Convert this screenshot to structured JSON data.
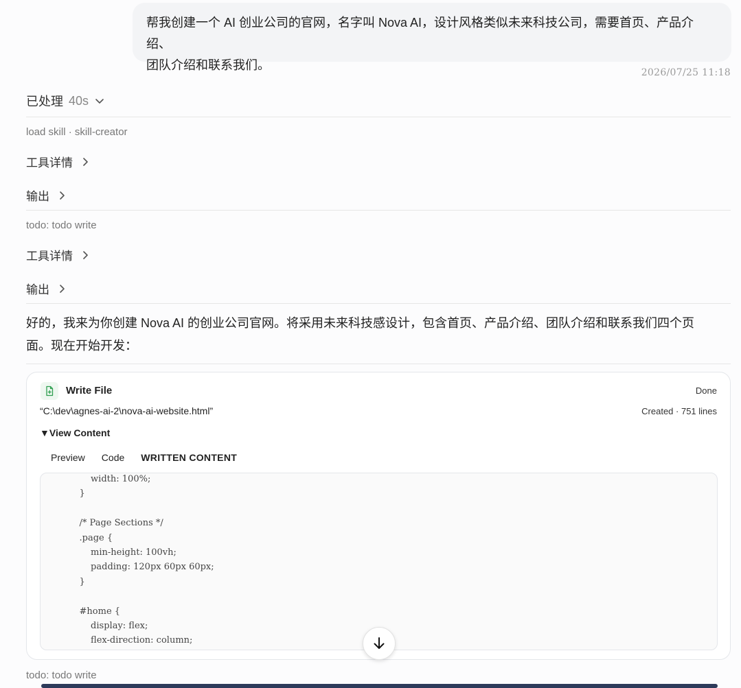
{
  "user_message": {
    "line1": "帮我创建一个 AI 创业公司的官网，名字叫 Nova AI，设计风格类似未来科技公司，需要首页、产品介绍、",
    "line2": "团队介绍和联系我们。",
    "timestamp": "2026/07/25  11:18"
  },
  "processed": {
    "label": "已处理",
    "duration": "40s"
  },
  "steps": [
    {
      "tool": "load skill · skill-creator",
      "details_label": "工具详情",
      "output_label": "输出"
    },
    {
      "tool": "todo: todo write",
      "details_label": "工具详情",
      "output_label": "输出"
    }
  ],
  "assistant": {
    "line1": "好的，我来为你创建 Nova AI 的创业公司官网。将采用未来科技感设计，包含首页、产品介绍、团队介绍和联系我们四个页",
    "line2": "面。现在开始开发："
  },
  "write_card": {
    "title": "Write File",
    "status": "Done",
    "path": "“C:\\dev\\agnes-ai-2\\nova-ai-website.html”",
    "meta": "Created · 751 lines",
    "view_content": "▼View Content",
    "tabs": [
      "Preview",
      "Code",
      "WRITTEN CONTENT"
    ],
    "code_lines": [
      "    width: 100%;",
      "}",
      "",
      "/* Page Sections */",
      ".page {",
      "    min-height: 100vh;",
      "    padding: 120px 60px 60px;",
      "}",
      "",
      "#home {",
      "    display: flex;",
      "    flex-direction: column;"
    ]
  },
  "next_step": {
    "tool": "todo: todo write"
  },
  "icons": {
    "file": "file-plus-icon",
    "scroll": "arrow-down-icon",
    "chevron": "chevron-right-icon",
    "expand": "chevron-down-icon"
  },
  "colors": {
    "file_icon": "#2e9e4f",
    "bottom_bar": "#2d3a5a"
  }
}
